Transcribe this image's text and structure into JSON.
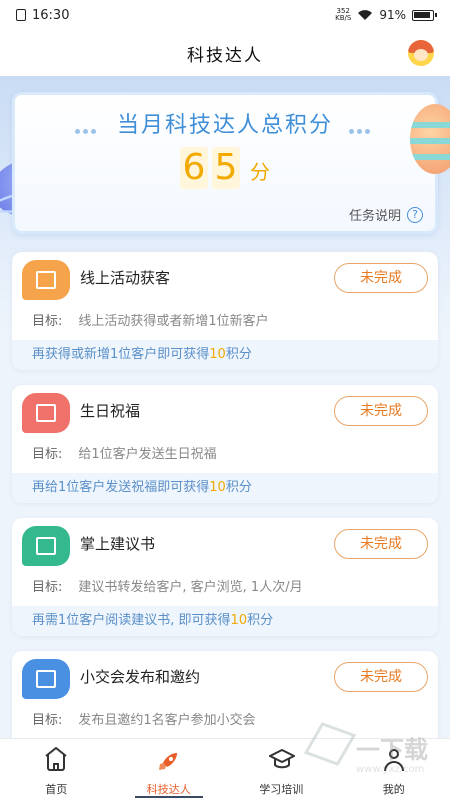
{
  "status_bar": {
    "time": "16:30",
    "net_speed_value": "352",
    "net_speed_unit": "KB/S",
    "battery": "91%"
  },
  "header": {
    "title": "科技达人"
  },
  "hero": {
    "title": "当月科技达人总积分",
    "score_digits": [
      "6",
      "5"
    ],
    "score_unit": "分",
    "task_link": "任务说明",
    "help_icon_text": "?"
  },
  "tasks": [
    {
      "name": "线上活动获客",
      "icon": "calendar-icon",
      "icon_color": "#f5a44c",
      "status": "未完成",
      "goal_label": "目标:",
      "goal": "线上活动获得或者新增1位新客户",
      "reward_prefix": "再获得或新增1位客户即可获得",
      "reward_points": "10",
      "reward_suffix": "积分"
    },
    {
      "name": "生日祝福",
      "icon": "gift-icon",
      "icon_color": "#f0706a",
      "status": "未完成",
      "goal_label": "目标:",
      "goal": "给1位客户发送生日祝福",
      "reward_prefix": "再给1位客户发送祝福即可获得",
      "reward_points": "10",
      "reward_suffix": "积分"
    },
    {
      "name": "掌上建议书",
      "icon": "message-icon",
      "icon_color": "#34b98f",
      "status": "未完成",
      "goal_label": "目标:",
      "goal": "建议书转发给客户, 客户浏览, 1人次/月",
      "reward_prefix": "再需1位客户阅读建议书, 即可获得",
      "reward_points": "10",
      "reward_suffix": "积分"
    },
    {
      "name": "小交会发布和邀约",
      "icon": "star-screen-icon",
      "icon_color": "#4a90e2",
      "status": "未完成",
      "goal_label": "目标:",
      "goal": "发布且邀约1名客户参加小交会"
    }
  ],
  "tabbar": {
    "items": [
      {
        "label": "首页",
        "icon": "home-icon"
      },
      {
        "label": "科技达人",
        "icon": "rocket-icon"
      },
      {
        "label": "学习培训",
        "icon": "graduation-cap-icon"
      },
      {
        "label": "我的",
        "icon": "user-icon"
      }
    ]
  },
  "watermark": {
    "text": "一下载",
    "sub": "www.yxz.com"
  }
}
